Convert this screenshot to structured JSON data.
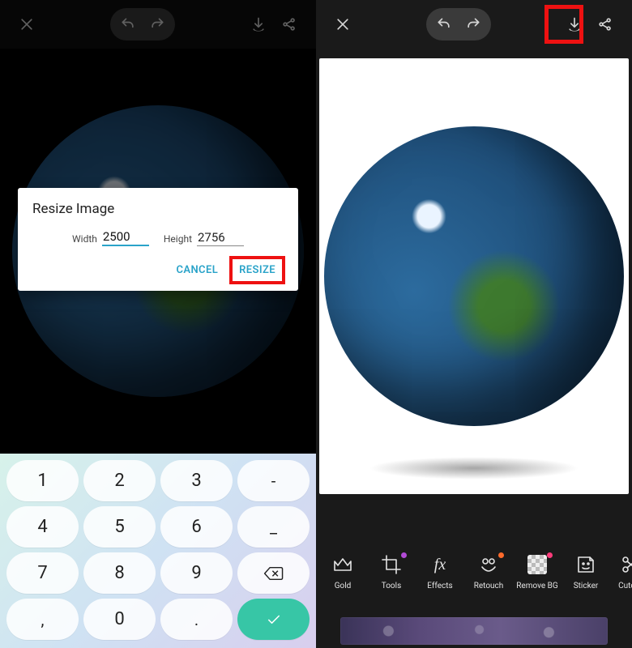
{
  "left": {
    "dialog": {
      "title": "Resize Image",
      "width_label": "Width",
      "width_value": "2500",
      "height_label": "Height",
      "height_value": "2756",
      "cancel": "CANCEL",
      "resize": "RESIZE"
    },
    "keypad": {
      "k1": "1",
      "k2": "2",
      "k3": "3",
      "kdash": "-",
      "k4": "4",
      "k5": "5",
      "k6": "6",
      "kunderscore": "_",
      "k7": "7",
      "k8": "8",
      "k9": "9",
      "kcomma": ",",
      "k0": "0",
      "kdot": "."
    }
  },
  "right": {
    "tools": {
      "gold": "Gold",
      "tools": "Tools",
      "effects": "Effects",
      "retouch": "Retouch",
      "removebg": "Remove BG",
      "sticker": "Sticker",
      "cutout": "Cutout"
    }
  }
}
